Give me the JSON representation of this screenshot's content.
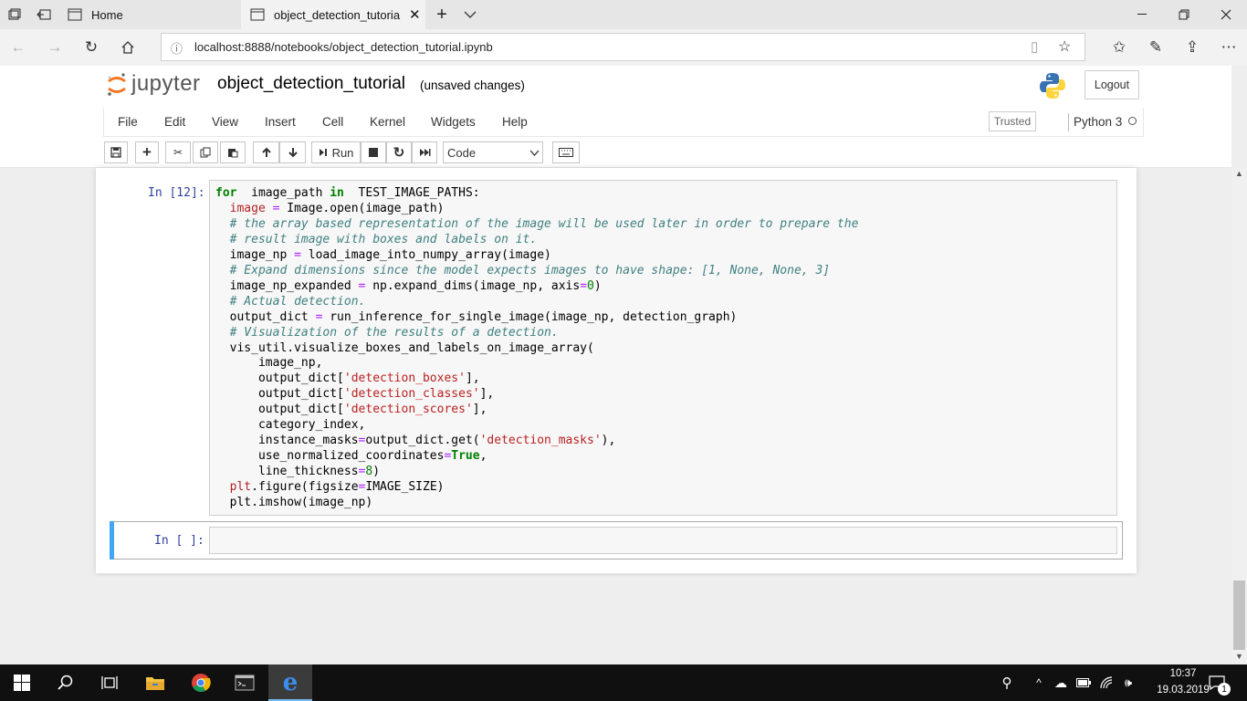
{
  "browser": {
    "tabs": [
      {
        "label": "Home"
      },
      {
        "label": "object_detection_tutoria"
      }
    ],
    "url": "localhost:8888/notebooks/object_detection_tutorial.ipynb"
  },
  "jupyter": {
    "logo_text": "jupyter",
    "notebook_name": "object_detection_tutorial",
    "save_status": "(unsaved changes)",
    "logout_label": "Logout",
    "menu": [
      "File",
      "Edit",
      "View",
      "Insert",
      "Cell",
      "Kernel",
      "Widgets",
      "Help"
    ],
    "trusted_label": "Trusted",
    "kernel_name": "Python 3",
    "toolbar": {
      "run_label": "Run",
      "cell_type": "Code"
    }
  },
  "cells": [
    {
      "prompt": "In [12]:"
    },
    {
      "prompt": "In [ ]:"
    }
  ],
  "code_lines": [
    {
      "tokens": [
        [
          "kw",
          "for"
        ],
        [
          "",
          "  image_path "
        ],
        [
          "kw",
          "in"
        ],
        [
          "",
          "  TEST_IMAGE_PATHS:"
        ]
      ]
    },
    {
      "tokens": [
        [
          "",
          "  "
        ],
        [
          "var",
          "image"
        ],
        [
          "",
          ""
        ],
        [
          "op",
          " ="
        ],
        [
          "",
          " Image.open(image_path)"
        ]
      ]
    },
    {
      "tokens": [
        [
          "",
          "  "
        ],
        [
          "cm",
          "# the array based representation of the image will be used later in order to prepare the"
        ]
      ]
    },
    {
      "tokens": [
        [
          "",
          "  "
        ],
        [
          "cm",
          "# result image with boxes and labels on it."
        ]
      ]
    },
    {
      "tokens": [
        [
          "",
          "  image_np "
        ],
        [
          "op",
          "="
        ],
        [
          "",
          " load_image_into_numpy_array(image)"
        ]
      ]
    },
    {
      "tokens": [
        [
          "",
          "  "
        ],
        [
          "cm",
          "# Expand dimensions since the model expects images to have shape: [1, None, None, 3]"
        ]
      ]
    },
    {
      "tokens": [
        [
          "",
          "  image_np_expanded "
        ],
        [
          "op",
          "="
        ],
        [
          "",
          " np.expand_dims(image_np, axis"
        ],
        [
          "op",
          "="
        ],
        [
          "nm",
          "0"
        ],
        [
          "",
          ")"
        ]
      ]
    },
    {
      "tokens": [
        [
          "",
          "  "
        ],
        [
          "cm",
          "# Actual detection."
        ]
      ]
    },
    {
      "tokens": [
        [
          "",
          "  output_dict "
        ],
        [
          "op",
          "="
        ],
        [
          "",
          " run_inference_for_single_image(image_np, detection_graph)"
        ]
      ]
    },
    {
      "tokens": [
        [
          "",
          "  "
        ],
        [
          "cm",
          "# Visualization of the results of a detection."
        ]
      ]
    },
    {
      "tokens": [
        [
          "",
          "  vis_util.visualize_boxes_and_labels_on_image_array("
        ]
      ]
    },
    {
      "tokens": [
        [
          "",
          "      image_np,"
        ]
      ]
    },
    {
      "tokens": [
        [
          "",
          "      output_dict["
        ],
        [
          "st",
          "'detection_boxes'"
        ],
        [
          "",
          "],"
        ]
      ]
    },
    {
      "tokens": [
        [
          "",
          "      output_dict["
        ],
        [
          "st",
          "'detection_classes'"
        ],
        [
          "",
          "],"
        ]
      ]
    },
    {
      "tokens": [
        [
          "",
          "      output_dict["
        ],
        [
          "st",
          "'detection_scores'"
        ],
        [
          "",
          "],"
        ]
      ]
    },
    {
      "tokens": [
        [
          "",
          "      category_index,"
        ]
      ]
    },
    {
      "tokens": [
        [
          "",
          "      instance_masks"
        ],
        [
          "op",
          "="
        ],
        [
          "",
          "output_dict.get("
        ],
        [
          "st",
          "'detection_masks'"
        ],
        [
          "",
          "),"
        ]
      ]
    },
    {
      "tokens": [
        [
          "",
          "      use_normalized_coordinates"
        ],
        [
          "op",
          "="
        ],
        [
          "kw",
          "True"
        ],
        [
          "",
          ","
        ]
      ]
    },
    {
      "tokens": [
        [
          "",
          "      line_thickness"
        ],
        [
          "op",
          "="
        ],
        [
          "nm",
          "8"
        ],
        [
          "",
          ")"
        ]
      ]
    },
    {
      "tokens": [
        [
          "",
          "  "
        ],
        [
          "var",
          "plt"
        ],
        [
          "",
          ".figure(figsize"
        ],
        [
          "op",
          "="
        ],
        [
          "",
          "IMAGE_SIZE)"
        ]
      ]
    },
    {
      "tokens": [
        [
          "",
          "  plt.imshow(image_np)"
        ]
      ]
    }
  ],
  "taskbar": {
    "time": "10:37",
    "date": "19.03.2019",
    "notification_count": "1"
  }
}
